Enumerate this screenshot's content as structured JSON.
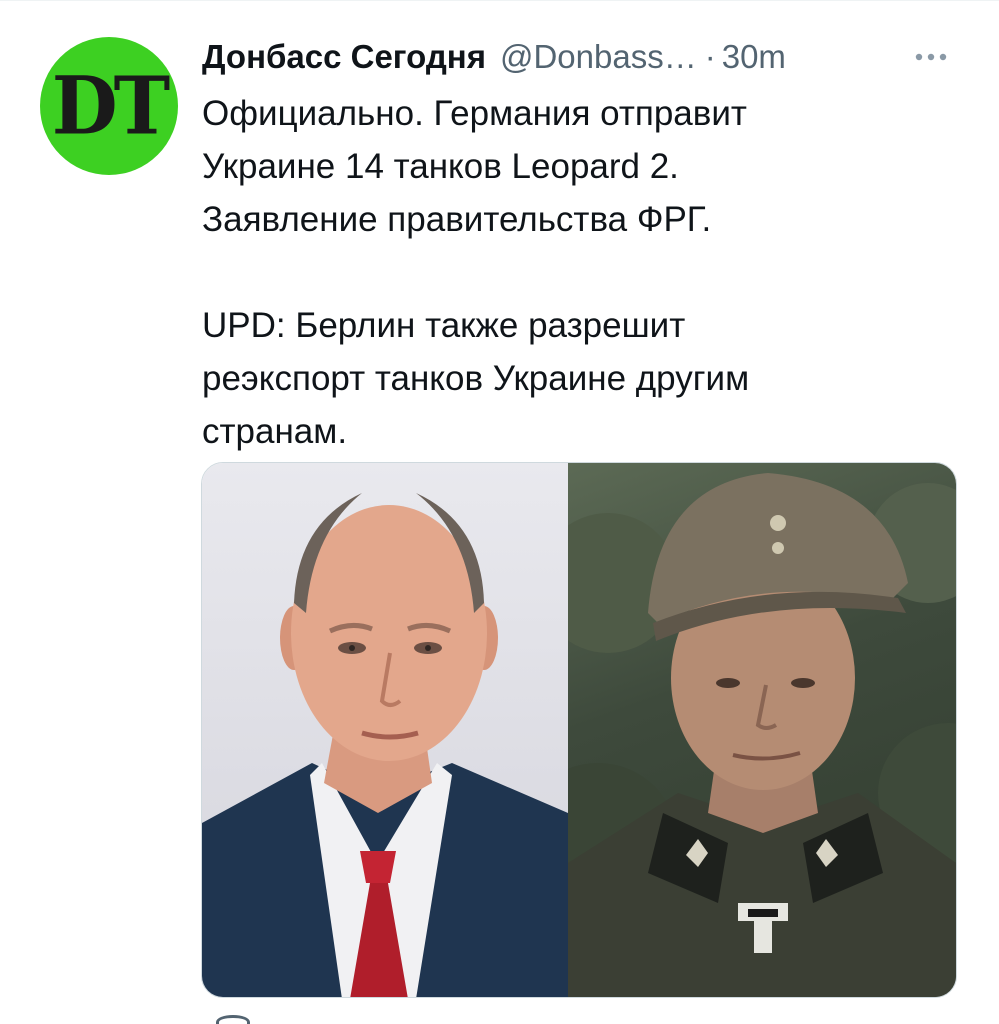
{
  "tweet": {
    "avatar_logo": "DT",
    "display_name": "Донбасс Сегодня",
    "handle": "@Donbass…",
    "separator": "·",
    "time": "30m",
    "text": {
      "line1": "Официально. Германия отправит",
      "line2": "Украине 14 танков Leopard 2.",
      "line3": "Заявление правительства ФРГ.",
      "line4": "UPD: Берлин также разрешит",
      "line5": "реэкспорт танков Украине другим",
      "line6": "странам."
    }
  },
  "icons": {
    "more": "more-horizontal-icon",
    "reply": "reply-icon"
  },
  "colors": {
    "avatar_bg": "#3dd022",
    "text_primary": "#0f1419",
    "text_secondary": "#536471"
  }
}
